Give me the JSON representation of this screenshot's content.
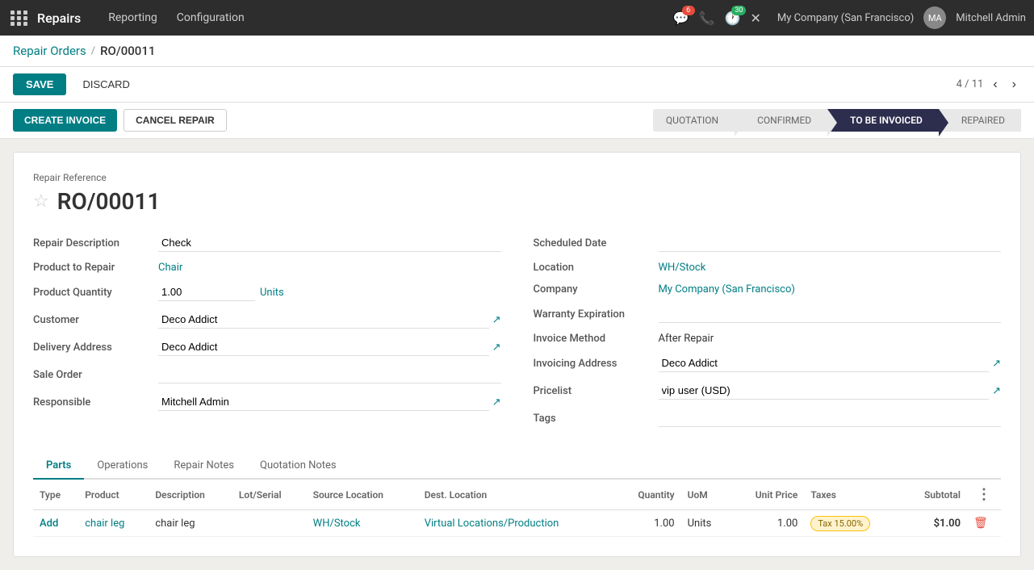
{
  "app": {
    "name": "Repairs",
    "menu_items": [
      "Reporting",
      "Configuration"
    ]
  },
  "navbar": {
    "notifications_count": "6",
    "activity_count": "30",
    "company": "My Company (San Francisco)",
    "username": "Mitchell Admin"
  },
  "breadcrumb": {
    "parent": "Repair Orders",
    "current": "RO/00011"
  },
  "actions": {
    "save": "SAVE",
    "discard": "DISCARD",
    "pagination": "4 / 11",
    "create_invoice": "CREATE INVOICE",
    "cancel_repair": "CANCEL REPAIR"
  },
  "status_steps": [
    {
      "label": "QUOTATION",
      "active": false
    },
    {
      "label": "CONFIRMED",
      "active": false
    },
    {
      "label": "TO BE INVOICED",
      "active": true
    },
    {
      "label": "REPAIRED",
      "active": false
    }
  ],
  "form": {
    "repair_ref_label": "Repair Reference",
    "repair_id": "RO/00011",
    "fields_left": [
      {
        "label": "Repair Description",
        "value": "Check",
        "type": "text"
      },
      {
        "label": "Product to Repair",
        "value": "Chair",
        "type": "link"
      },
      {
        "label": "Product Quantity",
        "value": "1.00",
        "unit": "Units",
        "type": "quantity"
      },
      {
        "label": "Customer",
        "value": "Deco Addict",
        "type": "select_ext"
      },
      {
        "label": "Delivery Address",
        "value": "Deco Addict",
        "type": "select_ext"
      },
      {
        "label": "Sale Order",
        "value": "",
        "type": "select"
      },
      {
        "label": "Responsible",
        "value": "Mitchell Admin",
        "type": "select_ext"
      }
    ],
    "fields_right": [
      {
        "label": "Scheduled Date",
        "value": "",
        "type": "select"
      },
      {
        "label": "Location",
        "value": "WH/Stock",
        "type": "link"
      },
      {
        "label": "Company",
        "value": "My Company (San Francisco)",
        "type": "link"
      },
      {
        "label": "Warranty Expiration",
        "value": "",
        "type": "select"
      },
      {
        "label": "Invoice Method",
        "value": "After Repair",
        "type": "text"
      },
      {
        "label": "Invoicing Address",
        "value": "Deco Addict",
        "type": "select_ext"
      },
      {
        "label": "Pricelist",
        "value": "vip user (USD)",
        "type": "select_ext"
      },
      {
        "label": "Tags",
        "value": "",
        "type": "select"
      }
    ]
  },
  "tabs": [
    "Parts",
    "Operations",
    "Repair Notes",
    "Quotation Notes"
  ],
  "active_tab": "Parts",
  "table": {
    "headers": [
      "Type",
      "Product",
      "Description",
      "Lot/Serial",
      "Source Location",
      "Dest. Location",
      "Quantity",
      "UoM",
      "Unit Price",
      "Taxes",
      "Subtotal"
    ],
    "rows": [
      {
        "type": "Add",
        "product": "chair leg",
        "description": "chair leg",
        "lot_serial": "",
        "source_location": "WH/Stock",
        "dest_location": "Virtual Locations/Production",
        "quantity": "1.00",
        "uom": "Units",
        "unit_price": "1.00",
        "taxes": "Tax 15.00%",
        "subtotal": "$1.00"
      }
    ]
  }
}
